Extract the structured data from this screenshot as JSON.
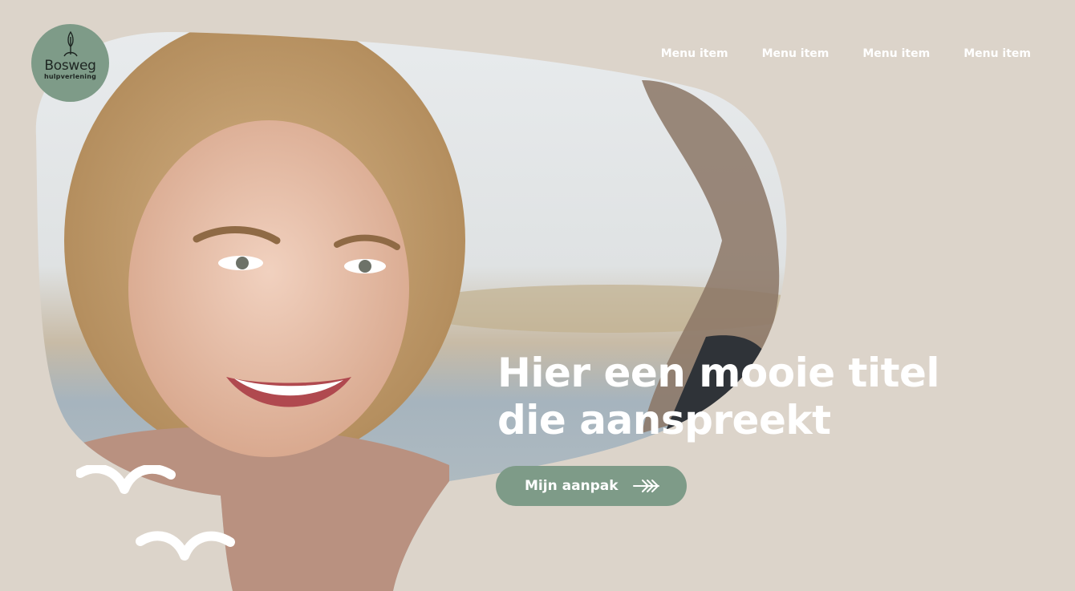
{
  "logo": {
    "name": "Bosweg",
    "tagline": "hulpverlening"
  },
  "nav": {
    "items": [
      "Menu item",
      "Menu item",
      "Menu item",
      "Menu item"
    ]
  },
  "hero": {
    "title_line_1": "Hier een mooie titel",
    "title_line_2": "die aanspreekt",
    "cta_label": "Mijn aanpak"
  },
  "colors": {
    "background": "#dcd4ca",
    "accent": "#7e9b88",
    "text_light": "#ffffff"
  },
  "icons": {
    "logo": "tree-icon",
    "cta": "triple-chevron-arrow-icon",
    "decoration": "birds-icon"
  }
}
